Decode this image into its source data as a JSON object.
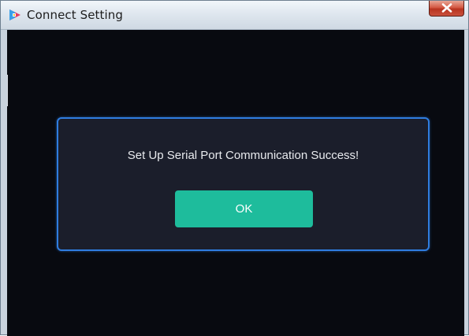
{
  "window": {
    "title": "Connect Setting",
    "app_icon": "app-logo-icon",
    "close_icon": "close-icon"
  },
  "dialog": {
    "message": "Set Up Serial Port Communication Success!",
    "ok_label": "OK"
  },
  "colors": {
    "background": "#080a10",
    "dialog_background": "#1b1e2b",
    "dialog_border": "#2f7de0",
    "button": "#1ebc9c",
    "close_button": "#c9513d"
  }
}
